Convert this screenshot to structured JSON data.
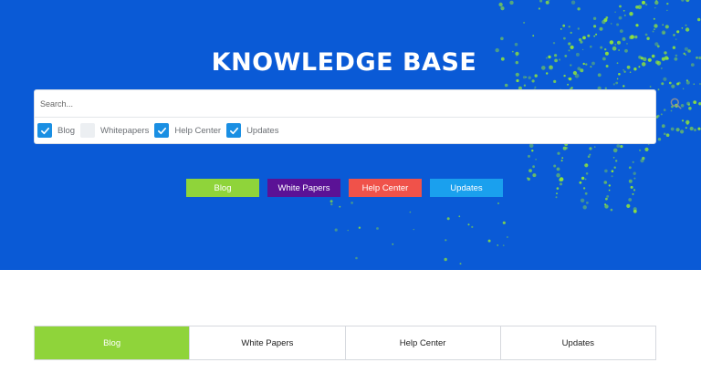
{
  "hero": {
    "title": "KNOWLEDGE BASE",
    "colors": {
      "background": "#0a5ad6",
      "dots": "#8fe33a"
    }
  },
  "search": {
    "placeholder": "Search...",
    "value": "",
    "icon": "search-icon"
  },
  "filters": [
    {
      "label": "Blog",
      "checked": true
    },
    {
      "label": "Whitepapers",
      "checked": false
    },
    {
      "label": "Help Center",
      "checked": true
    },
    {
      "label": "Updates",
      "checked": true
    }
  ],
  "hero_buttons": [
    {
      "label": "Blog",
      "color": "#8fd43a"
    },
    {
      "label": "White Papers",
      "color": "#5b1296"
    },
    {
      "label": "Help Center",
      "color": "#f0524a"
    },
    {
      "label": "Updates",
      "color": "#1aa0ee"
    }
  ],
  "tabs": [
    {
      "label": "Blog",
      "active": true
    },
    {
      "label": "White Papers",
      "active": false
    },
    {
      "label": "Help Center",
      "active": false
    },
    {
      "label": "Updates",
      "active": false
    }
  ]
}
